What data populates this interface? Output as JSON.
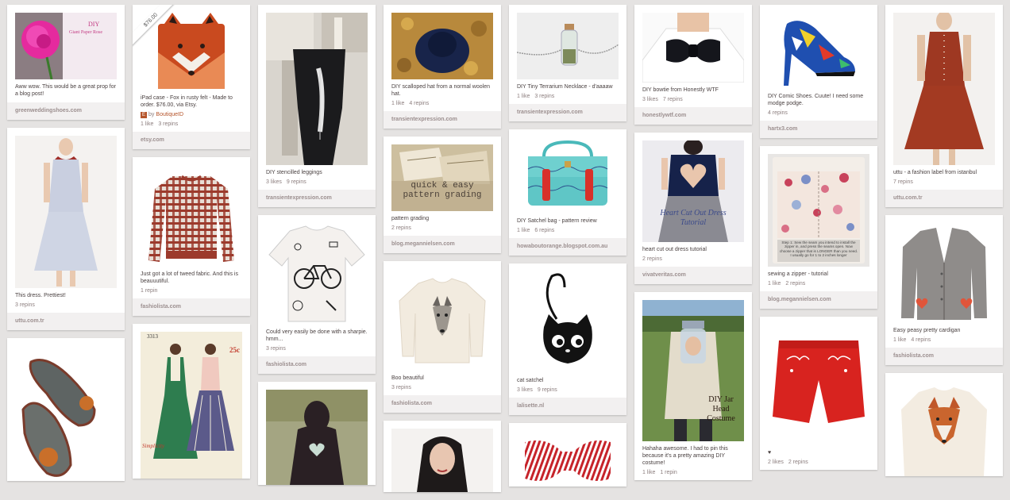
{
  "pins": {
    "c1p1": {
      "desc": "Aww wow. This would be a great prop for a blog post!",
      "src": "greenweddingshoes.com",
      "overlay_top": "DIY",
      "overlay_bottom": "Giant Paper Rose"
    },
    "c1p2": {
      "desc": "This dress. Prettiest!",
      "repins": "3 repins",
      "src": "uttu.com.tr"
    },
    "c1p3": {
      "desc": ""
    },
    "c2p1": {
      "desc": "iPad case - Fox in rusty felt - Made to order. $76.00, via Etsy.",
      "price": "$76.00",
      "via_by": "by",
      "via_name": "BoutiqueID",
      "likes": "1 like",
      "repins": "3 repins",
      "src": "etsy.com"
    },
    "c2p2": {
      "desc": "Just got a lot of tweed fabric. And this is beauuutiful.",
      "repins": "1 repin",
      "src": "fashiolista.com"
    },
    "c2p3": {
      "desc": "",
      "pattern_no": "3313",
      "pattern_brand": "Simplicity",
      "pattern_word": "PRINTED Pattern",
      "pattern_price": "25c"
    },
    "c3p1": {
      "desc": "DIY stencilled leggings",
      "likes": "3 likes",
      "repins": "9 repins",
      "src": "transientexpression.com"
    },
    "c3p2": {
      "desc": "Could very easily be done with a sharpie. hmm...",
      "repins": "3 repins",
      "src": "fashiolista.com"
    },
    "c3p3": {
      "desc": ""
    },
    "c4p1": {
      "desc": "DIY scalloped hat from a normal woolen hat.",
      "likes": "1 like",
      "repins": "4 repins",
      "src": "transientexpression.com"
    },
    "c4p2": {
      "desc": "pattern grading",
      "repins": "2 repins",
      "src": "blog.megannielsen.com",
      "overlay": "quick & easy pattern grading"
    },
    "c4p3": {
      "desc": "Boo beautiful",
      "repins": "3 repins",
      "src": "fashiolista.com"
    },
    "c4p4": {
      "desc": ""
    },
    "c5p1": {
      "desc": "DIY Tiny Terrarium Necklace - d'aaaaw",
      "likes": "1 like",
      "repins": "3 repins",
      "src": "transientexpression.com"
    },
    "c5p2": {
      "desc": "DIY Satchel bag - pattern review",
      "likes": "1 like",
      "repins": "6 repins",
      "src": "howaboutorange.blogspot.com.au"
    },
    "c5p3": {
      "desc": "cat satchel",
      "likes": "3 likes",
      "repins": "9 repins",
      "src": "lalisette.nl"
    },
    "c5p4": {
      "desc": ""
    },
    "c6p1": {
      "desc": "DIY bowtie from Honestly WTF",
      "likes": "3 likes",
      "repins": "7 repins",
      "src": "honestlywtf.com"
    },
    "c6p2": {
      "desc": "heart cut out dress tutorial",
      "repins": "2 repins",
      "src": "vivatveritas.com",
      "overlay": "Heart Cut Out Dress Tutorial"
    },
    "c6p3": {
      "desc": "Hahaha awesome. I had to pin this because it's a pretty amazing DIY costume!",
      "likes": "1 like",
      "repins": "1 repin",
      "overlay": "DIY Jar Head Costume"
    },
    "c7p1": {
      "desc": "DIY Comic Shoes. Cuute! I need some modge podge.",
      "repins": "4 repins",
      "src": "hartx3.com"
    },
    "c7p2": {
      "desc": "sewing a zipper - tutorial",
      "likes": "1 like",
      "repins": "2 repins",
      "src": "blog.megannielsen.com",
      "overlay": "Step 1: Sew the seam you intend to install the zipper in, and press the seams open. Now choose a zipper that is LONGER than you need. I usually go for 1 to 2 inches longer"
    },
    "c7p3": {
      "desc": "♥",
      "likes": "2 likes",
      "repins": "2 repins"
    },
    "c8p1": {
      "desc": "uttu - a fashion label from istanbul",
      "repins": "7 repins",
      "src": "uttu.com.tr"
    },
    "c8p2": {
      "desc": "Easy peasy pretty cardigan",
      "likes": "1 like",
      "repins": "4 repins",
      "src": "fashiolista.com"
    },
    "c8p3": {
      "desc": ""
    }
  }
}
